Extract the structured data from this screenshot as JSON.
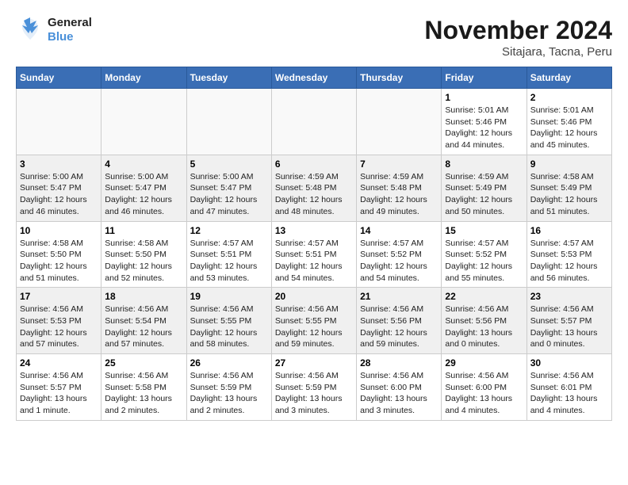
{
  "header": {
    "logo_line1": "General",
    "logo_line2": "Blue",
    "month": "November 2024",
    "location": "Sitajara, Tacna, Peru"
  },
  "weekdays": [
    "Sunday",
    "Monday",
    "Tuesday",
    "Wednesday",
    "Thursday",
    "Friday",
    "Saturday"
  ],
  "weeks": [
    [
      {
        "day": "",
        "info": ""
      },
      {
        "day": "",
        "info": ""
      },
      {
        "day": "",
        "info": ""
      },
      {
        "day": "",
        "info": ""
      },
      {
        "day": "",
        "info": ""
      },
      {
        "day": "1",
        "info": "Sunrise: 5:01 AM\nSunset: 5:46 PM\nDaylight: 12 hours and 44 minutes."
      },
      {
        "day": "2",
        "info": "Sunrise: 5:01 AM\nSunset: 5:46 PM\nDaylight: 12 hours and 45 minutes."
      }
    ],
    [
      {
        "day": "3",
        "info": "Sunrise: 5:00 AM\nSunset: 5:47 PM\nDaylight: 12 hours and 46 minutes."
      },
      {
        "day": "4",
        "info": "Sunrise: 5:00 AM\nSunset: 5:47 PM\nDaylight: 12 hours and 46 minutes."
      },
      {
        "day": "5",
        "info": "Sunrise: 5:00 AM\nSunset: 5:47 PM\nDaylight: 12 hours and 47 minutes."
      },
      {
        "day": "6",
        "info": "Sunrise: 4:59 AM\nSunset: 5:48 PM\nDaylight: 12 hours and 48 minutes."
      },
      {
        "day": "7",
        "info": "Sunrise: 4:59 AM\nSunset: 5:48 PM\nDaylight: 12 hours and 49 minutes."
      },
      {
        "day": "8",
        "info": "Sunrise: 4:59 AM\nSunset: 5:49 PM\nDaylight: 12 hours and 50 minutes."
      },
      {
        "day": "9",
        "info": "Sunrise: 4:58 AM\nSunset: 5:49 PM\nDaylight: 12 hours and 51 minutes."
      }
    ],
    [
      {
        "day": "10",
        "info": "Sunrise: 4:58 AM\nSunset: 5:50 PM\nDaylight: 12 hours and 51 minutes."
      },
      {
        "day": "11",
        "info": "Sunrise: 4:58 AM\nSunset: 5:50 PM\nDaylight: 12 hours and 52 minutes."
      },
      {
        "day": "12",
        "info": "Sunrise: 4:57 AM\nSunset: 5:51 PM\nDaylight: 12 hours and 53 minutes."
      },
      {
        "day": "13",
        "info": "Sunrise: 4:57 AM\nSunset: 5:51 PM\nDaylight: 12 hours and 54 minutes."
      },
      {
        "day": "14",
        "info": "Sunrise: 4:57 AM\nSunset: 5:52 PM\nDaylight: 12 hours and 54 minutes."
      },
      {
        "day": "15",
        "info": "Sunrise: 4:57 AM\nSunset: 5:52 PM\nDaylight: 12 hours and 55 minutes."
      },
      {
        "day": "16",
        "info": "Sunrise: 4:57 AM\nSunset: 5:53 PM\nDaylight: 12 hours and 56 minutes."
      }
    ],
    [
      {
        "day": "17",
        "info": "Sunrise: 4:56 AM\nSunset: 5:53 PM\nDaylight: 12 hours and 57 minutes."
      },
      {
        "day": "18",
        "info": "Sunrise: 4:56 AM\nSunset: 5:54 PM\nDaylight: 12 hours and 57 minutes."
      },
      {
        "day": "19",
        "info": "Sunrise: 4:56 AM\nSunset: 5:55 PM\nDaylight: 12 hours and 58 minutes."
      },
      {
        "day": "20",
        "info": "Sunrise: 4:56 AM\nSunset: 5:55 PM\nDaylight: 12 hours and 59 minutes."
      },
      {
        "day": "21",
        "info": "Sunrise: 4:56 AM\nSunset: 5:56 PM\nDaylight: 12 hours and 59 minutes."
      },
      {
        "day": "22",
        "info": "Sunrise: 4:56 AM\nSunset: 5:56 PM\nDaylight: 13 hours and 0 minutes."
      },
      {
        "day": "23",
        "info": "Sunrise: 4:56 AM\nSunset: 5:57 PM\nDaylight: 13 hours and 0 minutes."
      }
    ],
    [
      {
        "day": "24",
        "info": "Sunrise: 4:56 AM\nSunset: 5:57 PM\nDaylight: 13 hours and 1 minute."
      },
      {
        "day": "25",
        "info": "Sunrise: 4:56 AM\nSunset: 5:58 PM\nDaylight: 13 hours and 2 minutes."
      },
      {
        "day": "26",
        "info": "Sunrise: 4:56 AM\nSunset: 5:59 PM\nDaylight: 13 hours and 2 minutes."
      },
      {
        "day": "27",
        "info": "Sunrise: 4:56 AM\nSunset: 5:59 PM\nDaylight: 13 hours and 3 minutes."
      },
      {
        "day": "28",
        "info": "Sunrise: 4:56 AM\nSunset: 6:00 PM\nDaylight: 13 hours and 3 minutes."
      },
      {
        "day": "29",
        "info": "Sunrise: 4:56 AM\nSunset: 6:00 PM\nDaylight: 13 hours and 4 minutes."
      },
      {
        "day": "30",
        "info": "Sunrise: 4:56 AM\nSunset: 6:01 PM\nDaylight: 13 hours and 4 minutes."
      }
    ]
  ]
}
